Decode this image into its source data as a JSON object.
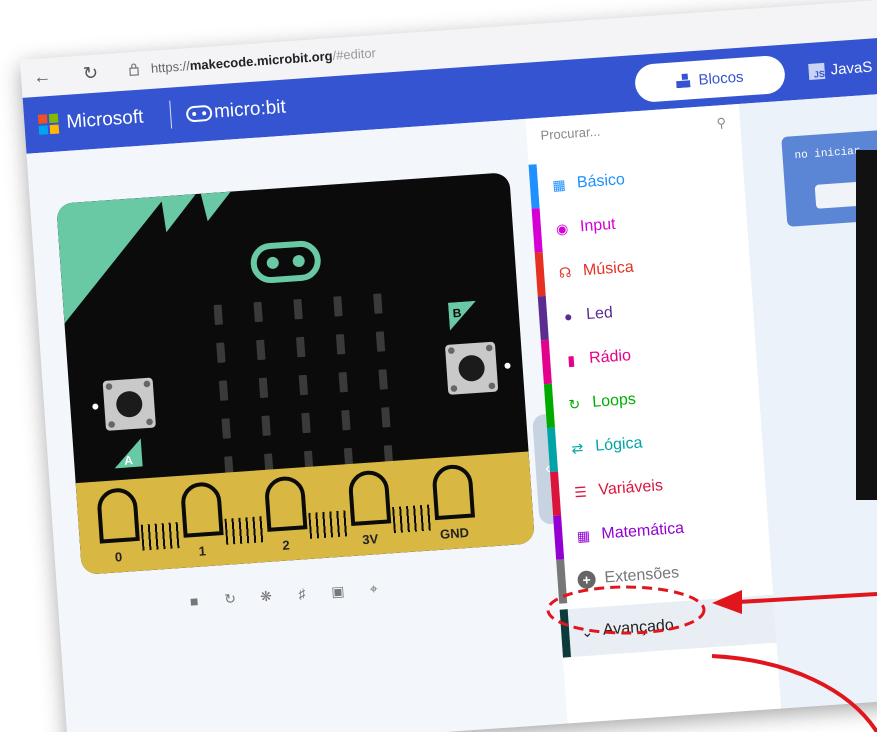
{
  "browser": {
    "url_prefix": "https://",
    "url_host": "makecode.microbit.org",
    "url_hash": "/#editor"
  },
  "header": {
    "brand": "Microsoft",
    "product": "micro:bit",
    "tab_blocks": "Blocos",
    "tab_js": "JavaS"
  },
  "simulator": {
    "button_a": "A",
    "button_b": "B",
    "pins": [
      "0",
      "1",
      "2",
      "3V",
      "GND"
    ]
  },
  "toolbox": {
    "search_placeholder": "Procurar...",
    "categories": [
      {
        "label": "Básico",
        "color": "#1e90ff",
        "icon": "grid-icon"
      },
      {
        "label": "Input",
        "color": "#d400d4",
        "icon": "input-icon"
      },
      {
        "label": "Música",
        "color": "#e63022",
        "icon": "headphones-icon"
      },
      {
        "label": "Led",
        "color": "#5c2d91",
        "icon": "toggle-icon"
      },
      {
        "label": "Rádio",
        "color": "#e3008c",
        "icon": "signal-icon"
      },
      {
        "label": "Loops",
        "color": "#00aa00",
        "icon": "loop-icon"
      },
      {
        "label": "Lógica",
        "color": "#00a4a6",
        "icon": "shuffle-icon"
      },
      {
        "label": "Variáveis",
        "color": "#dc143c",
        "icon": "list-icon"
      },
      {
        "label": "Matemática",
        "color": "#9400d3",
        "icon": "calculator-icon"
      }
    ],
    "extensions": "Extensões",
    "advanced": "Avançado"
  },
  "workspace": {
    "on_start": "no iniciar"
  },
  "colors": {
    "header": "#3454d1",
    "annotation": "#e0161c"
  }
}
